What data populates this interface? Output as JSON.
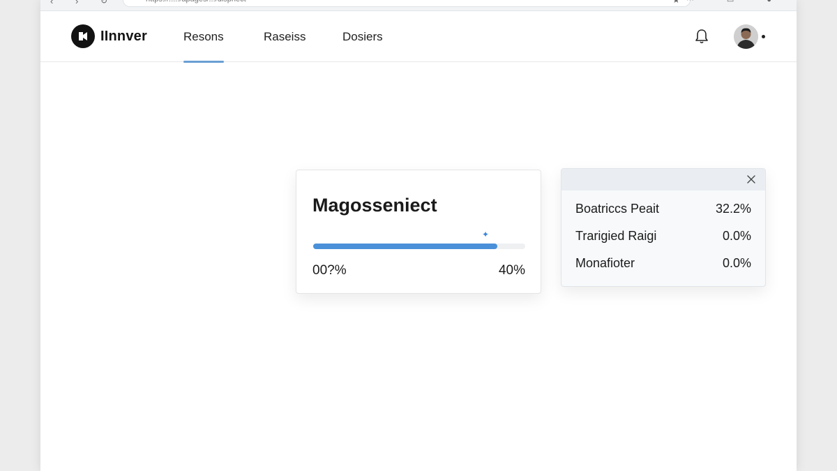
{
  "browser": {
    "url": "https://...../apages/.../dispnect",
    "nav_icons": "‹ ›",
    "reload_icon": "reload-icon",
    "tools_icons": "⋯ ▭ ●"
  },
  "app": {
    "name": "IInnver",
    "nav": [
      {
        "label": "Resons",
        "active": true
      },
      {
        "label": "Raseiss",
        "active": false
      },
      {
        "label": "Dosiers",
        "active": false
      }
    ],
    "accent_color": "#6a9fd4"
  },
  "progress_card": {
    "title": "Magosseniect",
    "progress_fraction": 0.87,
    "start_label": "00?%",
    "end_label": "40%",
    "bar_color": "#4a90d9"
  },
  "stats_panel": {
    "rows": [
      {
        "label": "Boatriccs Peait",
        "value": "32.2%"
      },
      {
        "label": "Trarigied Raigi",
        "value": "0.0%"
      },
      {
        "label": "Monafioter",
        "value": "0.0%"
      }
    ]
  }
}
